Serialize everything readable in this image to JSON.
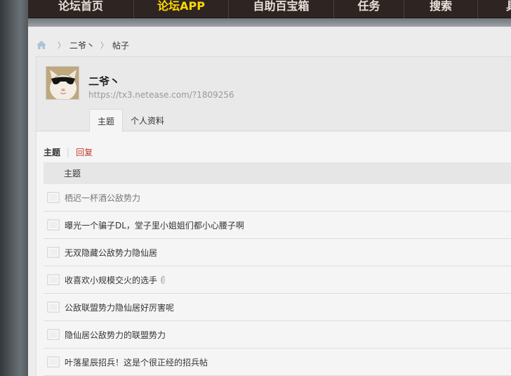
{
  "nav": {
    "items": [
      {
        "label": "论坛首页",
        "active": false
      },
      {
        "label": "论坛APP",
        "active": true
      },
      {
        "label": "自助百宝箱",
        "active": false
      },
      {
        "label": "任务",
        "active": false
      },
      {
        "label": "搜索",
        "active": false
      },
      {
        "label": "具",
        "active": false
      }
    ]
  },
  "breadcrumb": {
    "icon": "home-icon",
    "items": [
      "二爷丶",
      "帖子"
    ]
  },
  "profile": {
    "name": "二爷丶",
    "url": "https://tx3.netease.com/?1809256",
    "avatar_icon": "cat-with-sunglasses-avatar",
    "tabs": [
      {
        "label": "主题",
        "active": true
      },
      {
        "label": "个人资料",
        "active": false
      }
    ]
  },
  "subtabs": {
    "topics": "主题",
    "separator": "|",
    "replies": "回复"
  },
  "list": {
    "header": "主题",
    "rows": [
      {
        "title": "栖迟一杯酒公敌势力",
        "attachment": false
      },
      {
        "title": "曝光一个骗子DL，堂子里小姐姐们都小心腰子啊",
        "attachment": false
      },
      {
        "title": "无双隐藏公敌势力隐仙居",
        "attachment": false
      },
      {
        "title": "收喜欢小规模交火的选手",
        "attachment": true
      },
      {
        "title": "公敌联盟势力隐仙居好厉害呢",
        "attachment": false
      },
      {
        "title": "隐仙居公敌势力的联盟势力",
        "attachment": false
      },
      {
        "title": "叶落星辰招兵！这是个很正经的招兵帖",
        "attachment": false
      }
    ]
  },
  "colors": {
    "nav_bg": "#2e2522",
    "nav_active": "#ffd700",
    "reply_link": "#c0392b"
  }
}
